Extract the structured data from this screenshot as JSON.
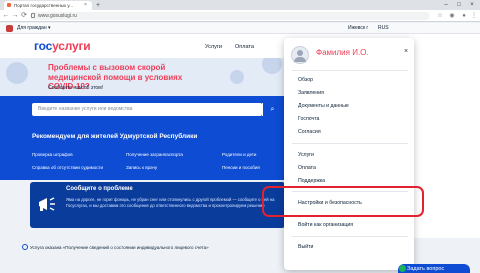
{
  "browser": {
    "tab_title": "Портал государственных у...",
    "new_tab": "+",
    "tab_close": "×",
    "url": "www.gosuslugi.ru",
    "back": "←",
    "forward": "→",
    "reload": "⟳",
    "win_min": "–",
    "win_max": "□",
    "win_close": "×"
  },
  "site": {
    "region": "Для граждан ▾",
    "city": "Ижевск г",
    "lang": "RUS",
    "logo_a": "гос",
    "logo_b": "услуги",
    "nav": [
      "Услуги",
      "Оплата"
    ]
  },
  "banner": {
    "title": "Проблемы с вызовом скорой медицинской помощи в условиях COVID-19?",
    "subtitle": "Сообщите нам об этом!"
  },
  "search": {
    "placeholder": "Введите название услуги или ведомства",
    "button_icon": "⌕"
  },
  "recommend": {
    "title": "Рекомендуем для жителей Удмуртской Республики",
    "links": [
      "Проверка штрафов",
      "Получение загранпаспорта",
      "Родители и дети",
      "Справка об отсутствии судимости",
      "Запись к врачу",
      "Пенсии и пособия"
    ]
  },
  "problem": {
    "title": "Сообщите о проблеме",
    "text": "Яма на дороге, не горит фонарь, не убран снег или столкнулись с другой проблемой — сообщите о ней на Госуслугах, и мы доставим это сообщение до ответственного ведомства и проконтролируем решение"
  },
  "service_line": "Услуга оказана «Получение сведений о состоянии индивидуального лицевого счета»",
  "dropdown": {
    "user": "Фамилия И.О.",
    "close": "×",
    "group1": [
      "Обзор",
      "Заявления",
      "Документы и данные",
      "Госпочта",
      "Согласия"
    ],
    "group2": [
      "Услуги",
      "Оплата",
      "Поддержка"
    ],
    "settings": "Настройки и безопасность",
    "org": "Войти как организация",
    "logout": "Выйти"
  },
  "chat": {
    "label": "Задать вопрос"
  },
  "colors": {
    "primary": "#0d4cd3",
    "accent": "#ee3f58",
    "highlight": "#e4212e"
  }
}
